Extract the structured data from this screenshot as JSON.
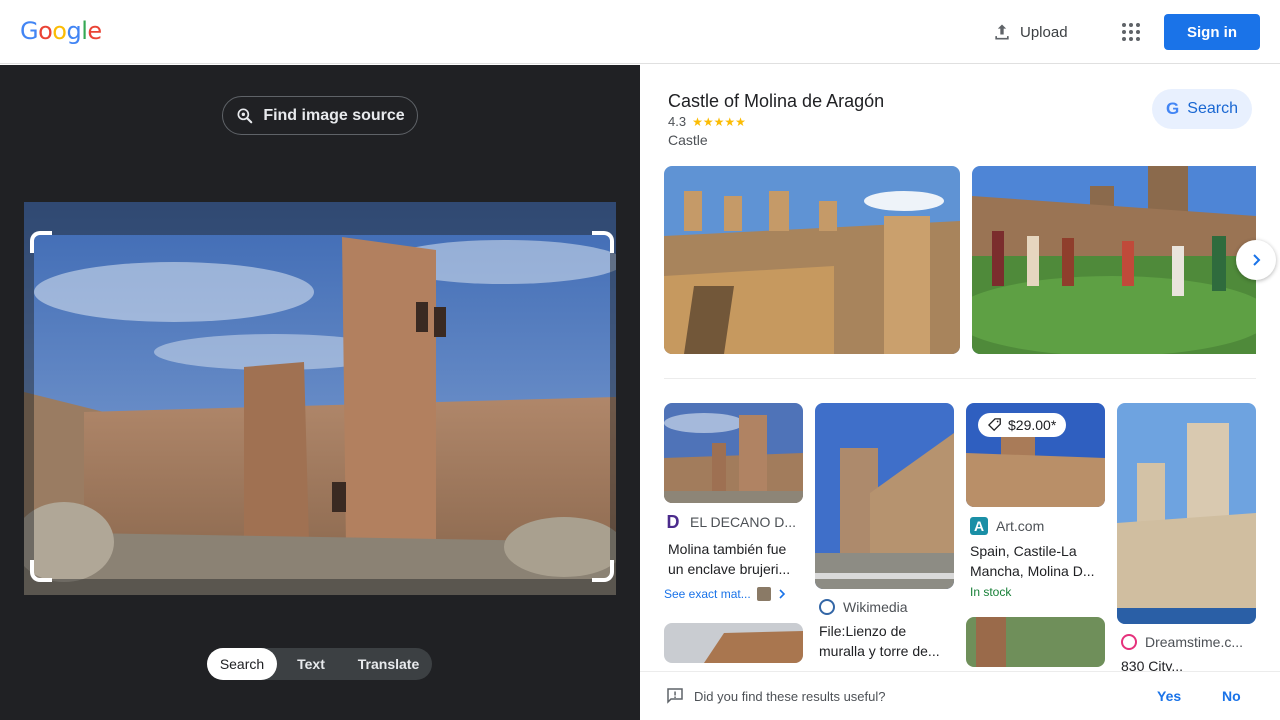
{
  "header": {
    "logo_letters": [
      "G",
      "o",
      "o",
      "g",
      "l",
      "e"
    ],
    "logo_colors": [
      "#4285f4",
      "#ea4335",
      "#fbbc05",
      "#4285f4",
      "#34a853",
      "#ea4335"
    ],
    "upload_label": "Upload",
    "signin_label": "Sign in"
  },
  "lens": {
    "find_source_label": "Find image source",
    "modes": [
      "Search",
      "Text",
      "Translate"
    ],
    "active_mode": "Search"
  },
  "knowledge_panel": {
    "title": "Castle of Molina de Aragón",
    "rating": "4.3",
    "stars": "★★★★★",
    "type": "Castle",
    "search_label": "Search"
  },
  "results": [
    {
      "source": "EL DECANO D...",
      "source_icon": "D",
      "title": "Molina también fue un enclave brujeri...",
      "extra": "See exact mat..."
    },
    {
      "source": "Wikimedia",
      "source_icon": "W",
      "title": "File:Lienzo de muralla y torre de..."
    },
    {
      "source": "Art.com",
      "source_icon": "A",
      "title": "Spain, Castile-La Mancha, Molina D...",
      "price": "$29.00*",
      "stock": "In stock"
    },
    {
      "source": "Dreamstime.c...",
      "source_icon": "d",
      "title": "830 City..."
    }
  ],
  "feedback": {
    "question": "Did you find these results useful?",
    "yes": "Yes",
    "no": "No"
  },
  "colors": {
    "accent": "#1a73e8",
    "dark_bg": "#202124",
    "star": "#fbbc04",
    "stock": "#188038"
  }
}
